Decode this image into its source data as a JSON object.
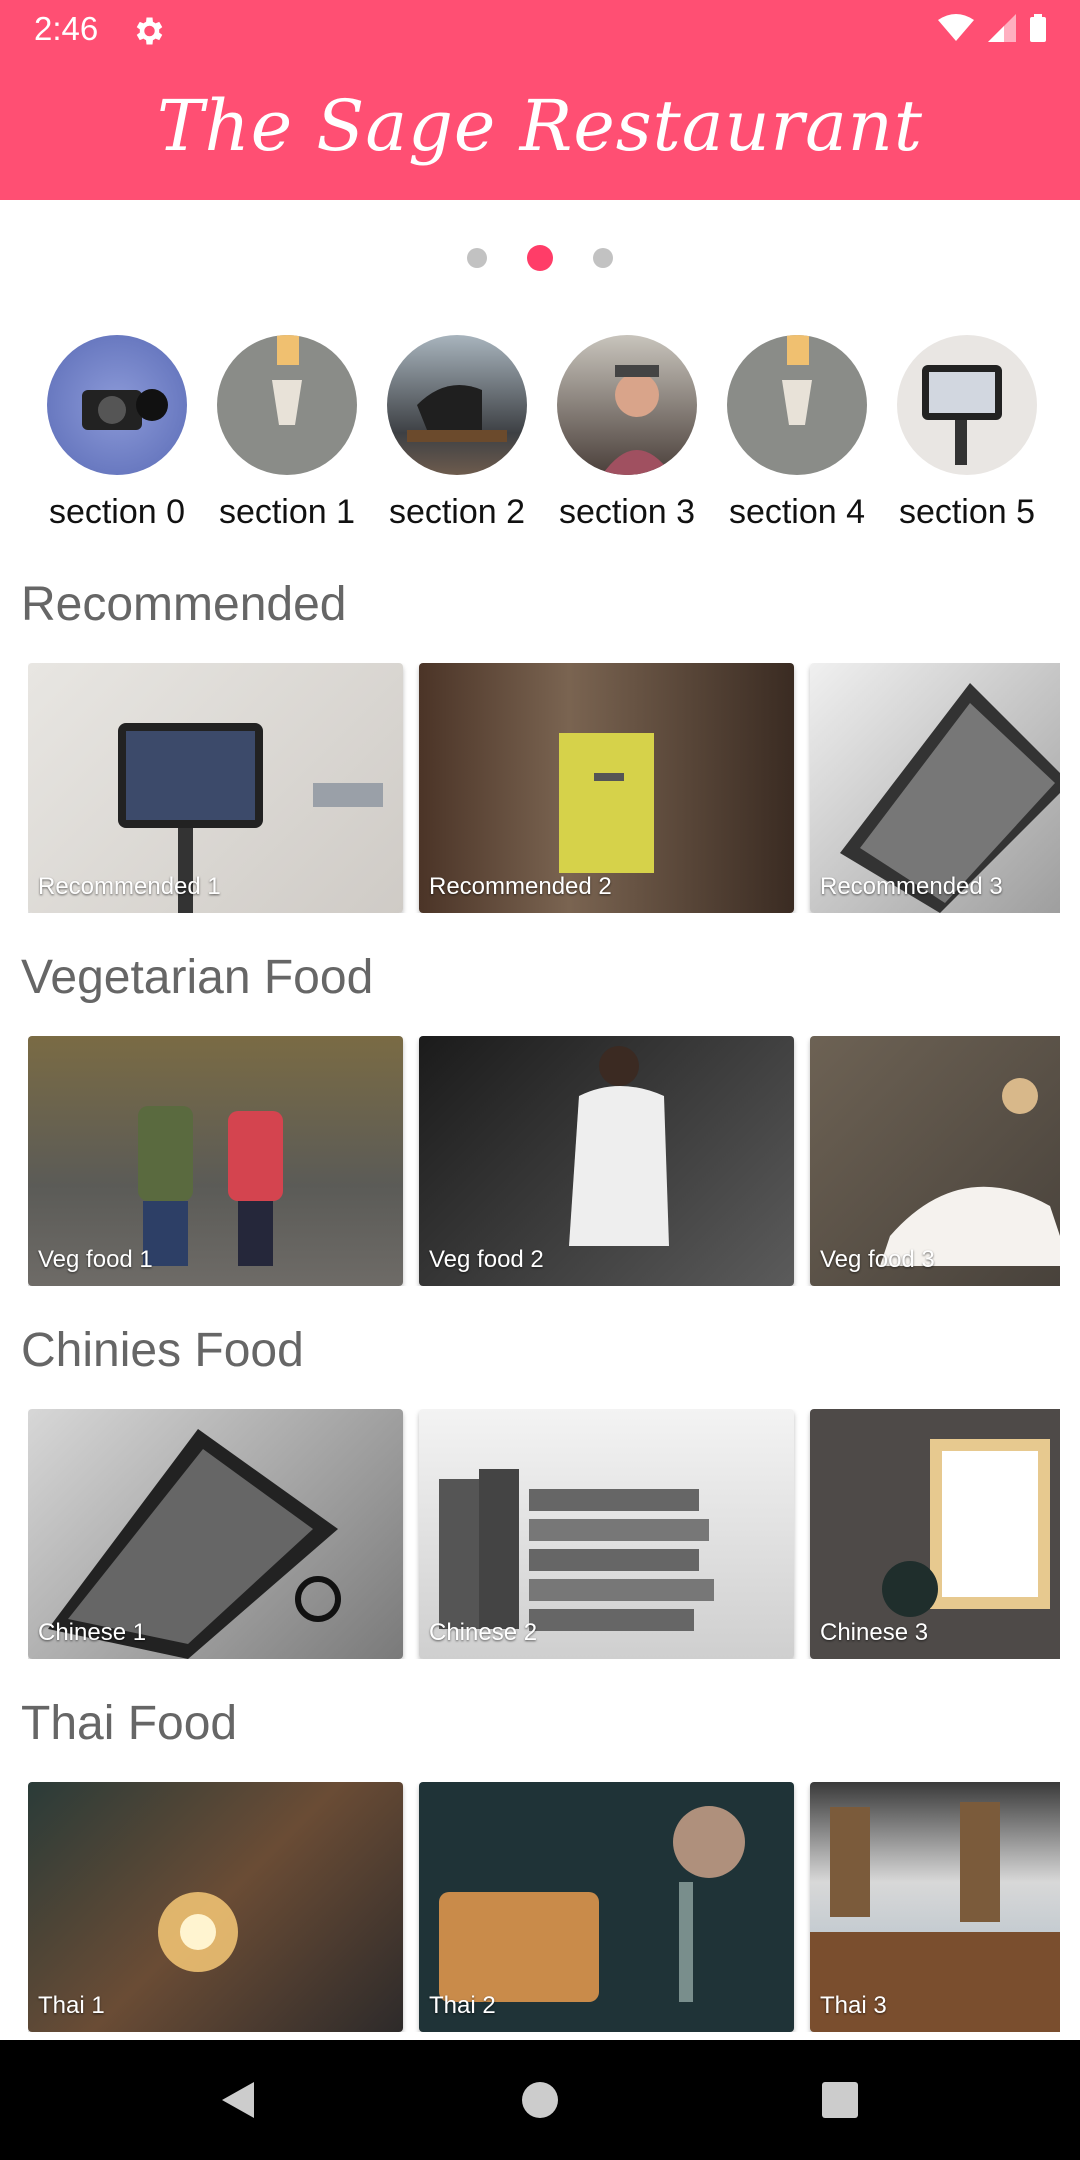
{
  "status": {
    "time": "2:46"
  },
  "app": {
    "title": "The Sage Restaurant",
    "accent": "#ff4f73"
  },
  "carousel": {
    "active_dot": 1,
    "count": 3
  },
  "sections": [
    {
      "label": "section 0"
    },
    {
      "label": "section 1"
    },
    {
      "label": "section 2"
    },
    {
      "label": "section 3"
    },
    {
      "label": "section 4"
    },
    {
      "label": "section 5"
    }
  ],
  "categories": [
    {
      "title": "Recommended",
      "cards": [
        "Recommended 1",
        "Recommended 2",
        "Recommended 3"
      ]
    },
    {
      "title": "Vegetarian Food",
      "cards": [
        "Veg food 1",
        "Veg food 2",
        "Veg food 3"
      ]
    },
    {
      "title": "Chinies Food",
      "cards": [
        "Chinese 1",
        "Chinese 2",
        "Chinese 3"
      ]
    },
    {
      "title": "Thai Food",
      "cards": [
        "Thai 1",
        "Thai 2",
        "Thai 3"
      ]
    }
  ],
  "icons": {
    "status_settings": "gear-icon",
    "status_wifi": "wifi-icon",
    "status_signal": "signal-icon",
    "status_battery": "battery-icon",
    "nav_back": "back-icon",
    "nav_home": "home-icon",
    "nav_recent": "recents-icon"
  }
}
